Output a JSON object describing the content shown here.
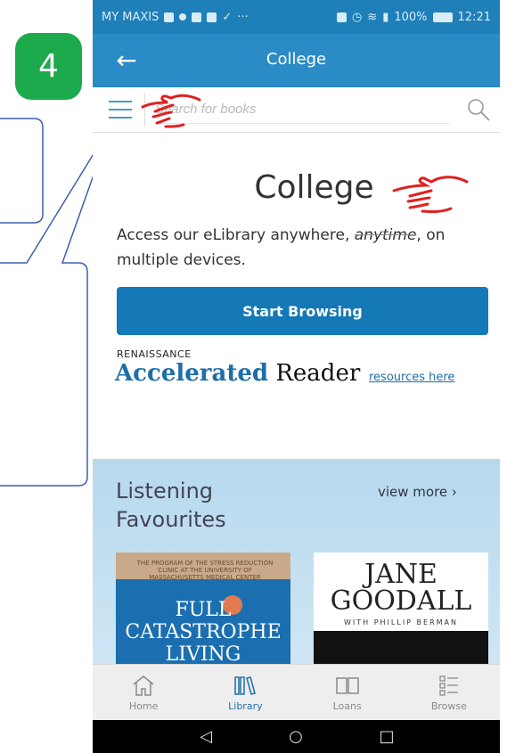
{
  "step": "4",
  "status": {
    "carrier": "MY MAXIS",
    "battery": "100%",
    "time": "12:21"
  },
  "appbar": {
    "title": "College"
  },
  "search": {
    "placeholder": "Search for books"
  },
  "main": {
    "heading": "College",
    "description_start": "Access our eLibrary anywhere, ",
    "description_emph": "anytime",
    "description_end": ", on multiple devices.",
    "start_label": "Start Browsing",
    "renaissance": "RENAISSANCE",
    "ar_bold": "Accelerated",
    "ar_reader": " Reader",
    "resources_link": "resources here"
  },
  "listening": {
    "title": "Listening Favourites",
    "view_more": "view more ›",
    "book1_note": "THE PROGRAM OF THE STRESS REDUCTION CLINIC AT THE UNIVERSITY OF MASSACHUSETTS MEDICAL CENTER",
    "book1_title_line1": "FULL",
    "book1_title_line2": "CATASTROPHE",
    "book1_title_line3": "LIVING",
    "book2_line1": "JANE",
    "book2_line2": "GOODALL",
    "book2_line3": "WITH PHILLIP BERMAN"
  },
  "bottom_nav": {
    "home": "Home",
    "library": "Library",
    "loans": "Loans",
    "browse": "Browse"
  },
  "colors": {
    "appbar": "#2b8bc6",
    "primary_button": "#1479b6",
    "step_badge": "#1daa4c",
    "pointer_red": "#e02020"
  }
}
